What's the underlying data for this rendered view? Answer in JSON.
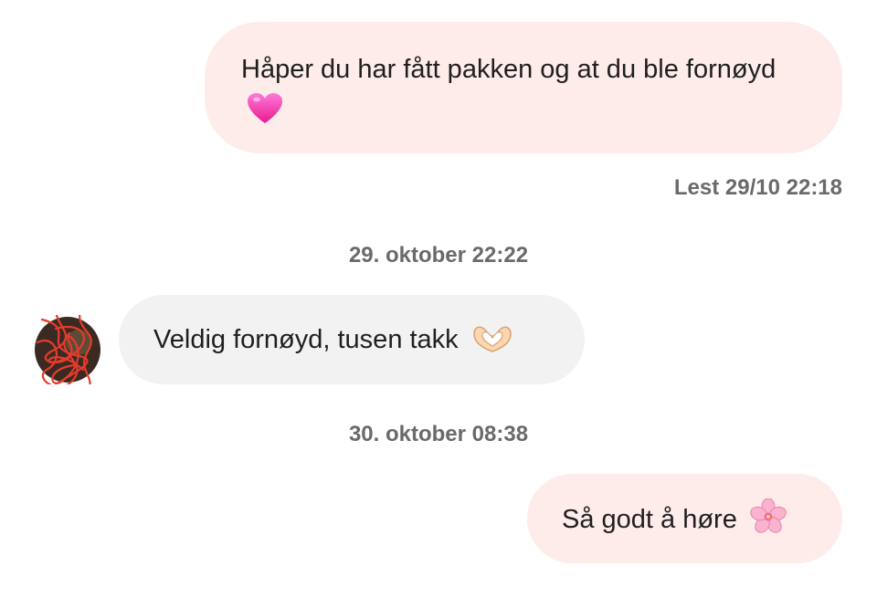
{
  "messages": [
    {
      "direction": "outgoing",
      "text": "Håper du har fått pakken og at du ble fornøyd",
      "emoji": "pink-heart"
    },
    {
      "direction": "incoming",
      "text": "Veldig fornøyd, tusen takk",
      "emoji": "heart-hands"
    },
    {
      "direction": "outgoing",
      "text": "Så godt å høre",
      "emoji": "cherry-blossom"
    }
  ],
  "read_receipt": "Lest 29/10 22:18",
  "timestamps": [
    "29. oktober 22:22",
    "30. oktober 08:38"
  ],
  "colors": {
    "outgoing_bubble": "#fdecea",
    "incoming_bubble": "#f2f2f2",
    "meta_text": "#6a6a6a",
    "scribble": "#e53b2c"
  }
}
